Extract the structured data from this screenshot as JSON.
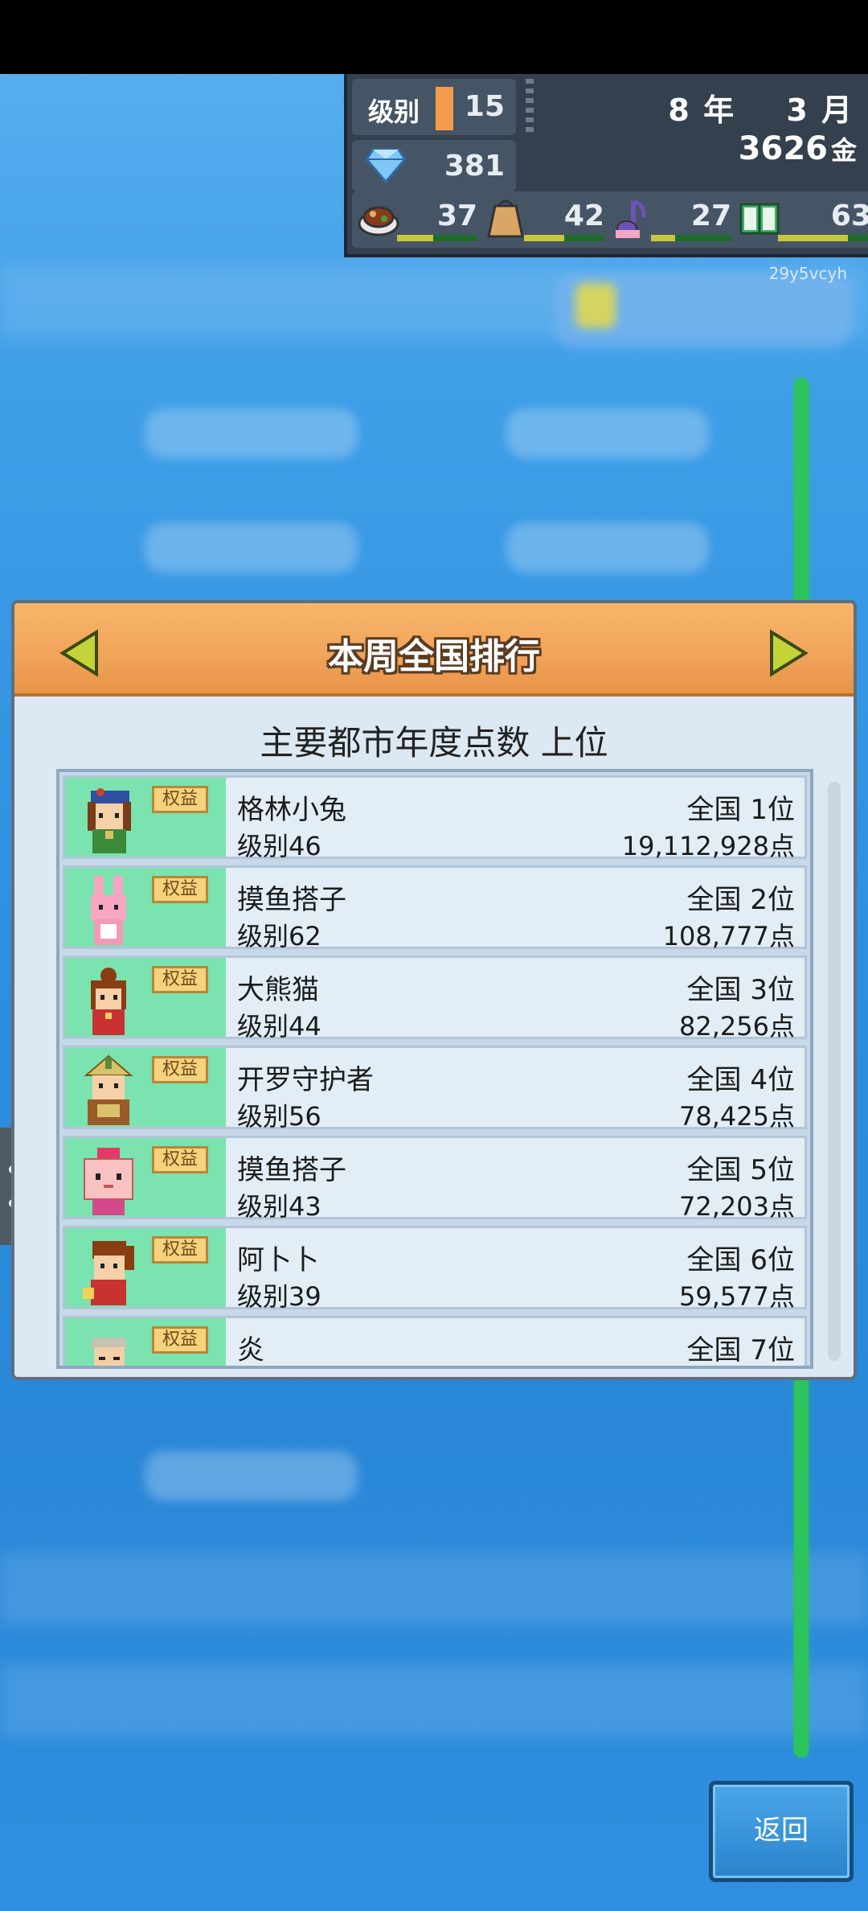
{
  "hud": {
    "level_label": "级别",
    "level_value": "15",
    "gems": "381",
    "year": "8 年",
    "month": "3 月",
    "gold": "3626",
    "gold_unit": "金",
    "stats": [
      {
        "icon": "food-icon",
        "value": "37",
        "fill": 0.45
      },
      {
        "icon": "bag-icon",
        "value": "42",
        "fill": 0.5
      },
      {
        "icon": "music-note-icon",
        "value": "27",
        "fill": 0.3
      },
      {
        "icon": "book-icon",
        "value": "63",
        "fill": 0.75
      }
    ]
  },
  "watermark_code": "29y5vcyh",
  "panel": {
    "title": "本周全国排行",
    "subtitle": "主要都市年度点数 上位",
    "badge_label": "权益",
    "rows": [
      {
        "name": "格林小兔",
        "level": "级别46",
        "rank": "全国 1位",
        "points": "19,112,928点",
        "avatar": "girl-beret-avatar"
      },
      {
        "name": "摸鱼搭子",
        "level": "级别62",
        "rank": "全国 2位",
        "points": "108,777点",
        "avatar": "pink-rabbit-avatar"
      },
      {
        "name": "大熊猫",
        "level": "级别44",
        "rank": "全国 3位",
        "points": "82,256点",
        "avatar": "girl-red-avatar"
      },
      {
        "name": "开罗守护者",
        "level": "级别56",
        "rank": "全国 4位",
        "points": "78,425点",
        "avatar": "samurai-avatar"
      },
      {
        "name": "摸鱼搭子",
        "level": "级别43",
        "rank": "全国 5位",
        "points": "72,203点",
        "avatar": "pink-box-avatar"
      },
      {
        "name": "阿卜卜",
        "level": "级别39",
        "rank": "全国 6位",
        "points": "59,577点",
        "avatar": "girl-ponytail-avatar"
      },
      {
        "name": "炎",
        "level": "",
        "rank": "全国 7位",
        "points": "",
        "avatar": "old-man-avatar"
      }
    ]
  },
  "back_label": "返回"
}
